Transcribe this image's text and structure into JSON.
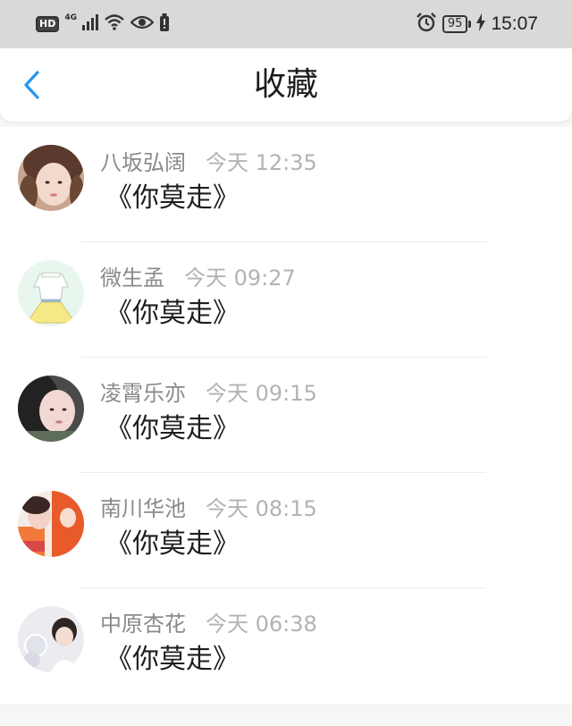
{
  "status_bar": {
    "hd_label": "HD",
    "network_type": "4G",
    "battery_level": "95",
    "time": "15:07"
  },
  "header": {
    "title": "收藏",
    "back_icon": "chevron-left-icon",
    "accent_color": "#2196f3"
  },
  "favorites": [
    {
      "name": "八坂弘阔",
      "time": "今天 12:35",
      "content": "《你莫走》"
    },
    {
      "name": "微生孟",
      "time": "今天 09:27",
      "content": "《你莫走》"
    },
    {
      "name": "凌霄乐亦",
      "time": "今天 09:15",
      "content": "《你莫走》"
    },
    {
      "name": "南川华池",
      "time": "今天 08:15",
      "content": "《你莫走》"
    },
    {
      "name": "中原杏花",
      "time": "今天 06:38",
      "content": "《你莫走》"
    }
  ]
}
